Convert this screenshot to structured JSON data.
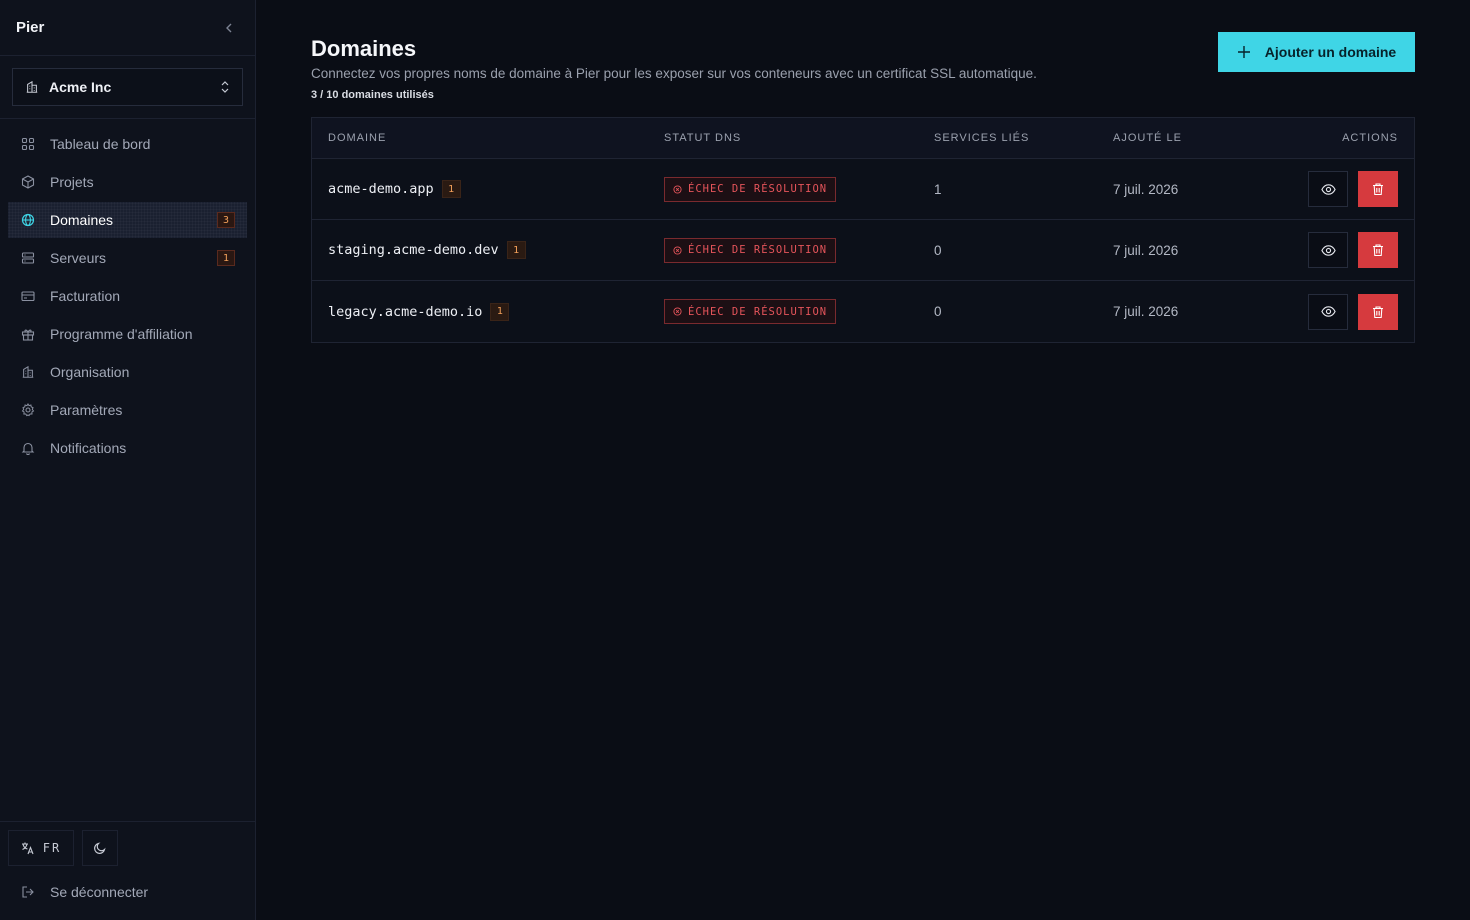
{
  "app": {
    "brand": "Pier"
  },
  "org": {
    "name": "Acme Inc"
  },
  "sidebar": {
    "items": [
      {
        "label": "Tableau de bord",
        "icon": "grid-icon",
        "badge": ""
      },
      {
        "label": "Projets",
        "icon": "box-icon",
        "badge": ""
      },
      {
        "label": "Domaines",
        "icon": "globe-icon",
        "badge": "3",
        "active": true
      },
      {
        "label": "Serveurs",
        "icon": "server-icon",
        "badge": "1"
      },
      {
        "label": "Facturation",
        "icon": "credit-card-icon",
        "badge": ""
      },
      {
        "label": "Programme d'affiliation",
        "icon": "gift-icon",
        "badge": ""
      },
      {
        "label": "Organisation",
        "icon": "building-icon",
        "badge": ""
      },
      {
        "label": "Paramètres",
        "icon": "gear-icon",
        "badge": ""
      },
      {
        "label": "Notifications",
        "icon": "bell-icon",
        "badge": ""
      }
    ],
    "lang": "FR",
    "logout": "Se déconnecter"
  },
  "page": {
    "title": "Domaines",
    "description": "Connectez vos propres noms de domaine à Pier pour les exposer sur vos conteneurs avec un certificat SSL automatique.",
    "usage": "3 / 10 domaines utilisés",
    "add_button": "Ajouter un domaine"
  },
  "table": {
    "headers": {
      "domain": "DOMAINE",
      "dns": "STATUT DNS",
      "services": "SERVICES LIÉS",
      "added": "AJOUTÉ LE",
      "actions": "ACTIONS"
    },
    "rows": [
      {
        "domain": "acme-demo.app",
        "badge": "1",
        "dns": "ÉCHEC DE RÉSOLUTION",
        "services": "1",
        "added": "7 juil. 2026"
      },
      {
        "domain": "staging.acme-demo.dev",
        "badge": "1",
        "dns": "ÉCHEC DE RÉSOLUTION",
        "services": "0",
        "added": "7 juil. 2026"
      },
      {
        "domain": "legacy.acme-demo.io",
        "badge": "1",
        "dns": "ÉCHEC DE RÉSOLUTION",
        "services": "0",
        "added": "7 juil. 2026"
      }
    ]
  },
  "colors": {
    "accent": "#3fd5e6",
    "danger": "#d63a3e",
    "warning_badge": "#f2a05a",
    "background": "#0a0d15"
  }
}
